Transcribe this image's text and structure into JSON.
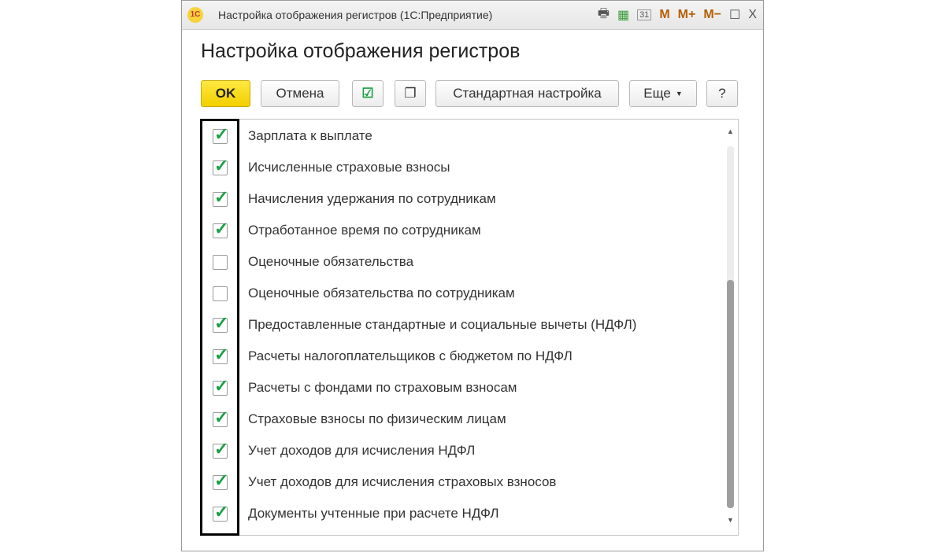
{
  "window": {
    "title": "Настройка отображения регистров  (1С:Предприятие)",
    "logo": "1С",
    "icons": [
      "print-icon",
      "calculator-icon",
      "calendar-icon"
    ],
    "calendar_day": "31",
    "m": "M",
    "mplus": "M+",
    "mminus": "M−",
    "maximize": "☐",
    "close": "X"
  },
  "heading": "Настройка отображения регистров",
  "toolbar": {
    "ok": "OK",
    "cancel": "Отмена",
    "standard": "Стандартная настройка",
    "more": "Еще",
    "help": "?"
  },
  "items": [
    {
      "label": "Зарплата к выплате",
      "checked": true
    },
    {
      "label": "Исчисленные страховые взносы",
      "checked": true
    },
    {
      "label": "Начисления удержания по сотрудникам",
      "checked": true
    },
    {
      "label": "Отработанное время по сотрудникам",
      "checked": true
    },
    {
      "label": "Оценочные обязательства",
      "checked": false
    },
    {
      "label": "Оценочные обязательства по сотрудникам",
      "checked": false
    },
    {
      "label": "Предоставленные стандартные и социальные вычеты (НДФЛ)",
      "checked": true
    },
    {
      "label": "Расчеты налогоплательщиков с бюджетом по НДФЛ",
      "checked": true
    },
    {
      "label": "Расчеты с фондами по страховым взносам",
      "checked": true
    },
    {
      "label": "Страховые взносы по физическим лицам",
      "checked": true
    },
    {
      "label": "Учет доходов для исчисления НДФЛ",
      "checked": true
    },
    {
      "label": "Учет доходов для исчисления страховых взносов",
      "checked": true
    },
    {
      "label": "Документы учтенные при расчете НДФЛ",
      "checked": true
    }
  ]
}
